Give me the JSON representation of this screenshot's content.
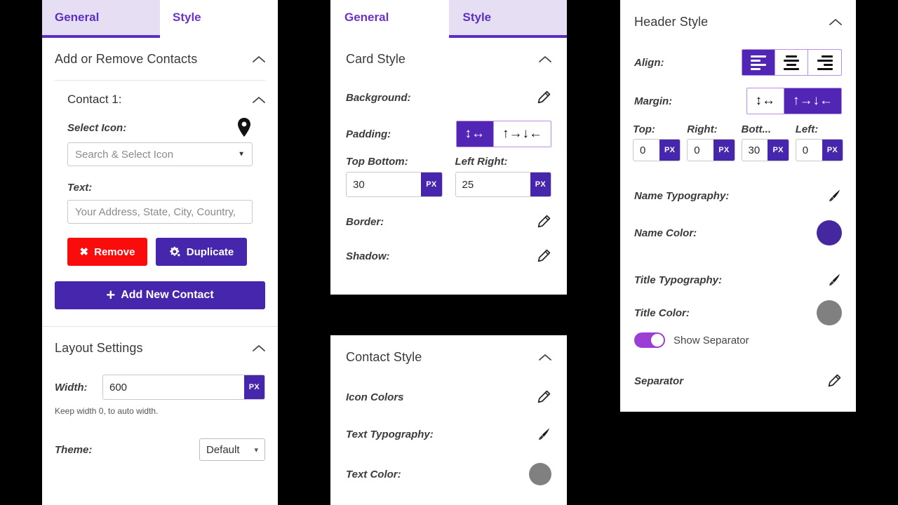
{
  "colors": {
    "accent_purple": "#4526ad",
    "tab_active_purple": "#5b2fc0",
    "tab_active_bg": "#e6dff4",
    "remove_red": "#fa0c0c",
    "name_color_swatch": "#4527a0",
    "title_color_swatch": "#808080",
    "text_color_swatch": "#808080",
    "switch_on": "#9b3fd4",
    "segment_active": "#5226b5",
    "page_background": "#000000"
  },
  "panel_general": {
    "tabs": [
      {
        "label": "General",
        "active": true
      },
      {
        "label": "Style",
        "active": false
      }
    ],
    "section": {
      "title": "Add or Remove Contacts",
      "collapse_icon": "chevron-up-icon"
    },
    "contact": {
      "title": "Contact 1:",
      "collapse_icon": "chevron-up-icon",
      "select_icon_label": "Select Icon:",
      "selected_icon": "map-pin-icon",
      "icon_select_placeholder": "Search & Select Icon",
      "text_label": "Text:",
      "text_placeholder": "Your Address, State, City, Country,",
      "remove_label": "Remove",
      "remove_icon": "close-x-icon",
      "duplicate_label": "Duplicate",
      "duplicate_icon": "gear-clone-icon",
      "add_label": "Add New Contact",
      "add_icon": "plus-icon"
    },
    "layout": {
      "title": "Layout Settings",
      "collapse_icon": "chevron-up-icon",
      "width_label": "Width:",
      "width_value": "600",
      "width_unit": "PX",
      "width_hint": "Keep width 0, to auto width.",
      "theme_label": "Theme:",
      "theme_value": "Default",
      "theme_caret": "chevron-down-icon"
    }
  },
  "panel_style": {
    "tabs": [
      {
        "label": "General",
        "active": false
      },
      {
        "label": "Style",
        "active": true
      }
    ],
    "card_style": {
      "title": "Card Style",
      "collapse_icon": "chevron-up-icon",
      "background_label": "Background:",
      "background_icon": "pencil-icon",
      "padding_label": "Padding:",
      "padding_modes": [
        {
          "icon": "linked-axis-icon",
          "glyphs": "↕↔",
          "active": true
        },
        {
          "icon": "unlinked-sides-icon",
          "glyphs": "↑→↓←",
          "active": false
        }
      ],
      "top_bottom_label": "Top Bottom:",
      "top_bottom_value": "30",
      "top_bottom_unit": "PX",
      "left_right_label": "Left Right:",
      "left_right_value": "25",
      "left_right_unit": "PX",
      "border_label": "Border:",
      "border_icon": "pencil-icon",
      "shadow_label": "Shadow:",
      "shadow_icon": "pencil-icon"
    }
  },
  "panel_contact_style": {
    "title": "Contact Style",
    "collapse_icon": "chevron-up-icon",
    "icon_colors_label": "Icon Colors",
    "icon_colors_icon": "pencil-icon",
    "text_typography_label": "Text Typography:",
    "text_typography_icon": "brush-icon",
    "text_color_label": "Text Color:",
    "text_color_swatch": "#808080"
  },
  "panel_header_style": {
    "title": "Header Style",
    "collapse_icon": "chevron-up-icon",
    "align_label": "Align:",
    "align_options": [
      {
        "icon": "align-left-icon",
        "active": true
      },
      {
        "icon": "align-center-icon",
        "active": false
      },
      {
        "icon": "align-right-icon",
        "active": false
      }
    ],
    "margin_label": "Margin:",
    "margin_modes": [
      {
        "icon": "linked-axis-icon",
        "glyphs": "↕↔",
        "active": false
      },
      {
        "icon": "unlinked-sides-icon",
        "glyphs": "↑→↓←",
        "active": true
      }
    ],
    "margin_fields": [
      {
        "label": "Top:",
        "value": "0",
        "unit": "PX"
      },
      {
        "label": "Right:",
        "value": "0",
        "unit": "PX"
      },
      {
        "label": "Bott...",
        "value": "30",
        "unit": "PX"
      },
      {
        "label": "Left:",
        "value": "0",
        "unit": "PX"
      }
    ],
    "name_typography_label": "Name Typography:",
    "name_typography_icon": "brush-icon",
    "name_color_label": "Name Color:",
    "name_color_swatch": "#4527a0",
    "title_typography_label": "Title Typography:",
    "title_typography_icon": "brush-icon",
    "title_color_label": "Title Color:",
    "title_color_swatch": "#808080",
    "show_separator_label": "Show Separator",
    "show_separator_on": true,
    "separator_label": "Separator",
    "separator_icon": "pencil-icon"
  }
}
